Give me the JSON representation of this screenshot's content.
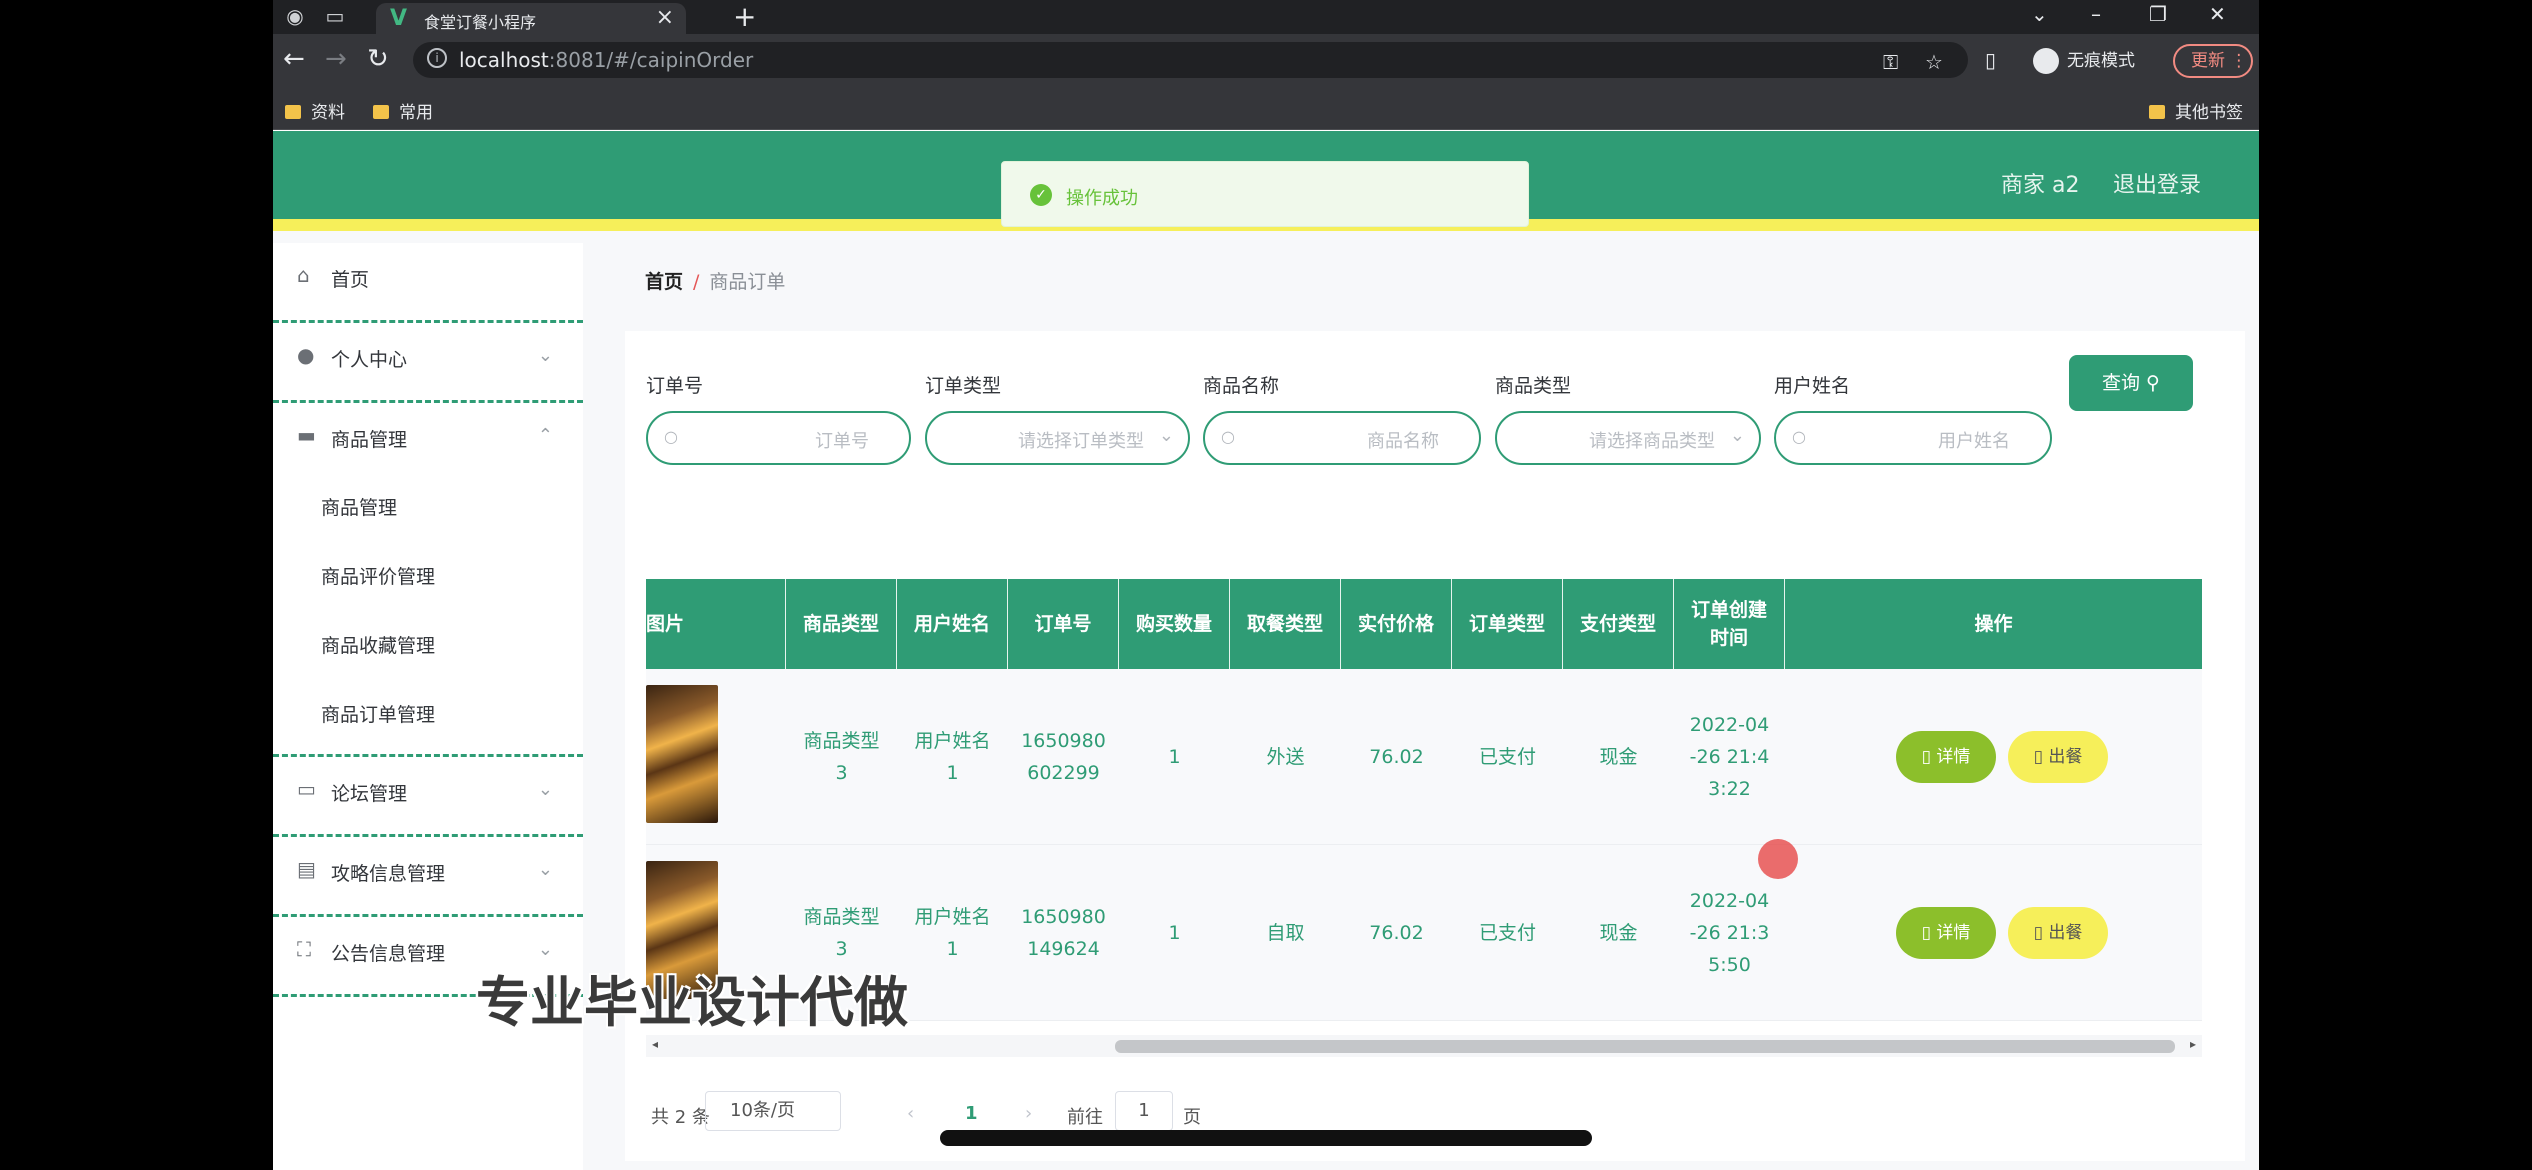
{
  "browser": {
    "tab_title": "食堂订餐小程序",
    "url_host": "localhost",
    "url_rest": ":8081/#/caipinOrder",
    "incognito_label": "无痕模式",
    "update_label": "更新",
    "bookmarks": [
      "资料",
      "常用"
    ],
    "other_bookmarks": "其他书签"
  },
  "header": {
    "toast": "操作成功",
    "user": "商家 a2",
    "logout": "退出登录"
  },
  "sidebar": {
    "items": [
      {
        "label": "首页",
        "icon": "home-icon"
      },
      {
        "label": "个人中心",
        "icon": "user-icon"
      },
      {
        "label": "商品管理",
        "icon": "briefcase-icon"
      },
      {
        "label": "论坛管理",
        "icon": "forum-icon"
      },
      {
        "label": "攻略信息管理",
        "icon": "clipboard-icon"
      },
      {
        "label": "公告信息管理",
        "icon": "fullscreen-icon"
      }
    ],
    "sub_items": [
      "商品管理",
      "商品评价管理",
      "商品收藏管理",
      "商品订单管理"
    ]
  },
  "breadcrumb": {
    "home": "首页",
    "sep": "/",
    "current": "商品订单"
  },
  "filters": {
    "order_no": {
      "label": "订单号",
      "placeholder": "订单号"
    },
    "order_type": {
      "label": "订单类型",
      "placeholder": "请选择订单类型"
    },
    "goods_name": {
      "label": "商品名称",
      "placeholder": "商品名称"
    },
    "goods_type": {
      "label": "商品类型",
      "placeholder": "请选择商品类型"
    },
    "user_name": {
      "label": "用户姓名",
      "placeholder": "用户姓名"
    },
    "search_label": "查询"
  },
  "table": {
    "headers": [
      "图片",
      "商品类型",
      "用户姓名",
      "订单号",
      "购买数量",
      "取餐类型",
      "实付价格",
      "订单类型",
      "支付类型",
      "订单创建时间",
      "操作"
    ],
    "rows": [
      {
        "goods_type": "商品类型3",
        "user": "用户姓名1",
        "order_no": "1650980602299",
        "qty": "1",
        "pickup": "外送",
        "price": "76.02",
        "order_type": "已支付",
        "pay": "现金",
        "time": "2022-04-26 21:43:22"
      },
      {
        "goods_type": "商品类型3",
        "user": "用户姓名1",
        "order_no": "1650980149624",
        "qty": "1",
        "pickup": "自取",
        "price": "76.02",
        "order_type": "已支付",
        "pay": "现金",
        "time": "2022-04-26 21:35:50"
      }
    ],
    "detail_label": "详情",
    "out_label": "出餐"
  },
  "pagination": {
    "total": "共 2 条",
    "page_size": "10条/页",
    "current": "1",
    "goto": "前往",
    "goto_value": "1",
    "page_unit": "页"
  },
  "watermark": "专业毕业设计代做"
}
